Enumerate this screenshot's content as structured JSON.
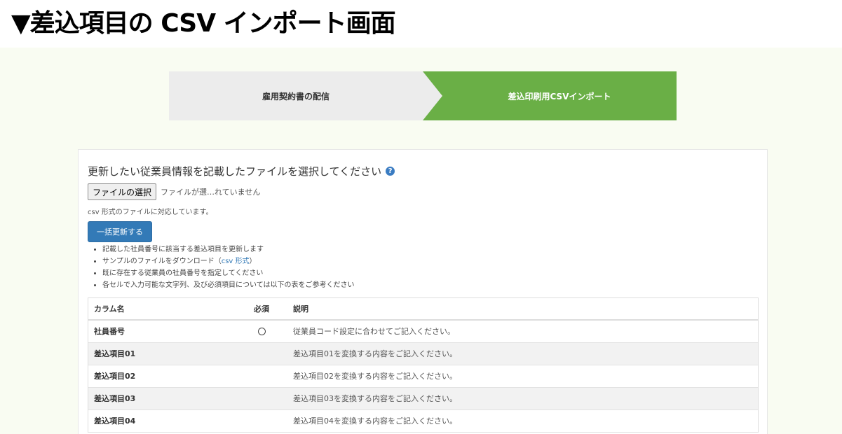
{
  "heading": "▼差込項目の CSV インポート画面",
  "steps": [
    {
      "label": "雇用契約書の配信"
    },
    {
      "label": "差込印刷用CSVインポート"
    }
  ],
  "form": {
    "title": "更新したい従業員情報を記載したファイルを選択してください",
    "help_icon": "?",
    "file_button": "ファイルの選択",
    "file_status": "ファイルが選…れていません",
    "format_note": "csv 形式のファイルに対応しています。",
    "bulk_button": "一括更新する"
  },
  "notes": {
    "n1": "記載した社員番号に該当する差込項目を更新します",
    "n2_prefix": "サンプルのファイルをダウンロード（",
    "n2_link": "csv 形式",
    "n2_suffix": "）",
    "n3": "既に存在する従業員の社員番号を指定してください",
    "n4": "各セルで入力可能な文字列、及び必須項目については以下の表をご参考ください"
  },
  "table": {
    "headers": {
      "name": "カラム名",
      "required": "必須",
      "description": "説明"
    },
    "rows": [
      {
        "name": "社員番号",
        "required": "○",
        "description": "従業員コード設定に合わせてご記入ください。"
      },
      {
        "name": "差込項目01",
        "required": "",
        "description": "差込項目01を変換する内容をご記入ください。"
      },
      {
        "name": "差込項目02",
        "required": "",
        "description": "差込項目02を変換する内容をご記入ください。"
      },
      {
        "name": "差込項目03",
        "required": "",
        "description": "差込項目03を変換する内容をご記入ください。"
      },
      {
        "name": "差込項目04",
        "required": "",
        "description": "差込項目04を変換する内容をご記入ください。"
      }
    ]
  },
  "colors": {
    "step_active": "#6aaf46",
    "step_inactive": "#ececec",
    "primary_button": "#337ab7",
    "background": "#f9fcf2"
  }
}
